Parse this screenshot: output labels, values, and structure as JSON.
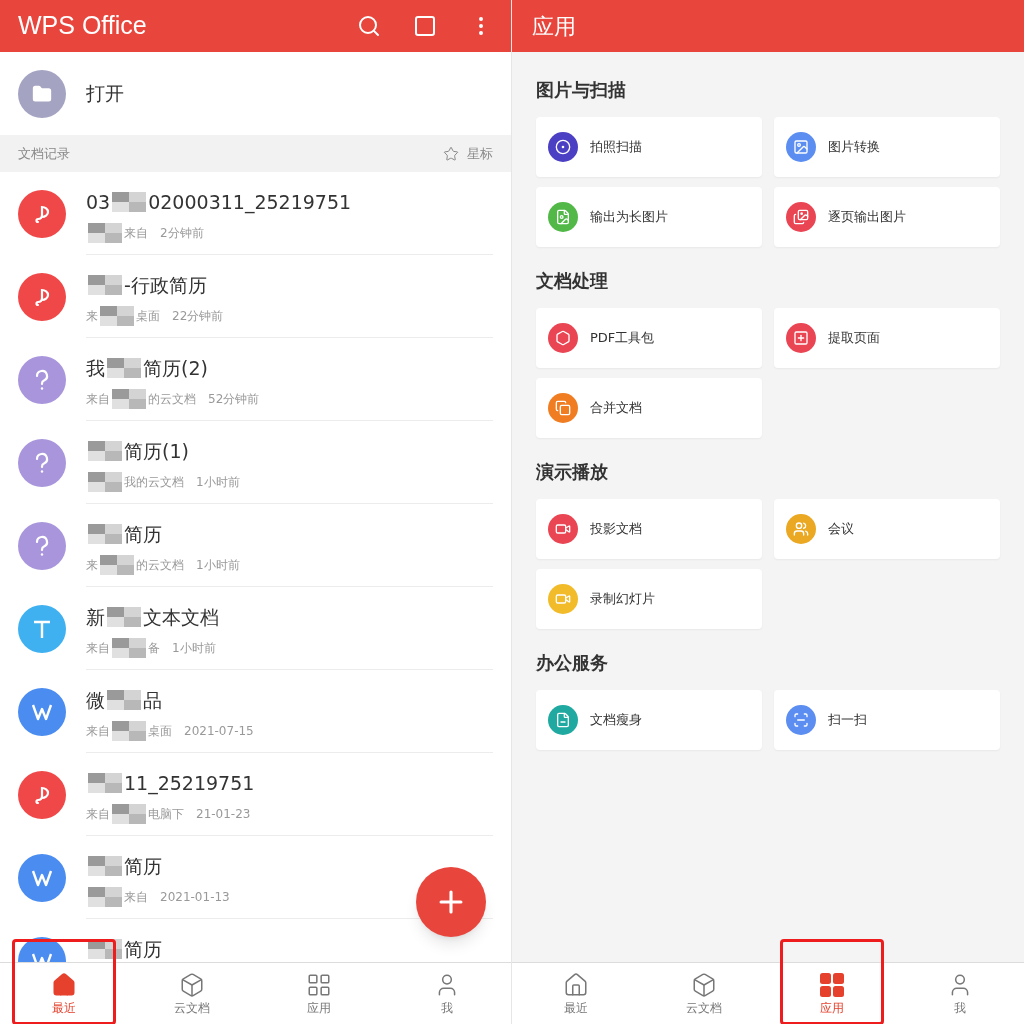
{
  "left": {
    "title": "WPS Office",
    "open_label": "打开",
    "section_label": "文档记录",
    "star_label": "星标",
    "files": [
      {
        "kind": "pdf",
        "name": [
          "03",
          "02000311_25219751"
        ],
        "source": [
          "来自"
        ],
        "time": "2分钟前"
      },
      {
        "kind": "pdf",
        "name": [
          "-行政简历"
        ],
        "source": [
          "来",
          "桌面"
        ],
        "time": "22分钟前"
      },
      {
        "kind": "unknown",
        "name": [
          "我",
          "简历(2)"
        ],
        "source": [
          "来自",
          "的云文档"
        ],
        "time": "52分钟前"
      },
      {
        "kind": "unknown",
        "name": [
          "简历(1)"
        ],
        "source": [
          "我的云文档"
        ],
        "time": "1小时前"
      },
      {
        "kind": "unknown",
        "name": [
          "简历"
        ],
        "source": [
          "来",
          "的云文档"
        ],
        "time": "1小时前"
      },
      {
        "kind": "text",
        "name": [
          "新",
          "文本文档"
        ],
        "source": [
          "来自",
          "备"
        ],
        "time": "1小时前"
      },
      {
        "kind": "writer",
        "name": [
          "微",
          "品"
        ],
        "source": [
          "来自",
          "桌面"
        ],
        "time": "2021-07-15"
      },
      {
        "kind": "pdf",
        "name": [
          "11_25219751"
        ],
        "source": [
          "来自",
          "电脑下"
        ],
        "time": "21-01-23"
      },
      {
        "kind": "writer",
        "name": [
          "简历"
        ],
        "source": [
          "来自"
        ],
        "time": "2021-01-13"
      },
      {
        "kind": "writer",
        "name": [
          "简历"
        ]
      }
    ],
    "nav": [
      {
        "label": "最近",
        "selected": true,
        "highlighted": true
      },
      {
        "label": "云文档",
        "selected": false,
        "highlighted": false
      },
      {
        "label": "应用",
        "selected": false,
        "highlighted": false
      },
      {
        "label": "我",
        "selected": false,
        "highlighted": false
      }
    ]
  },
  "right": {
    "title": "应用",
    "sections": [
      {
        "title": "图片与扫描",
        "tools": [
          {
            "label": "拍照扫描",
            "color": "#4b3fc4"
          },
          {
            "label": "图片转换",
            "color": "#5b8ef0"
          },
          {
            "label": "输出为长图片",
            "color": "#52b948"
          },
          {
            "label": "逐页输出图片",
            "color": "#ea4553"
          }
        ]
      },
      {
        "title": "文档处理",
        "tools": [
          {
            "label": "PDF工具包",
            "color": "#ea4553"
          },
          {
            "label": "提取页面",
            "color": "#ea4553"
          },
          {
            "label": "合并文档",
            "color": "#f07d22"
          }
        ]
      },
      {
        "title": "演示播放",
        "tools": [
          {
            "label": "投影文档",
            "color": "#ea4553"
          },
          {
            "label": "会议",
            "color": "#eba823"
          },
          {
            "label": "录制幻灯片",
            "color": "#f1bb2a"
          }
        ]
      },
      {
        "title": "办公服务",
        "tools": [
          {
            "label": "文档瘦身",
            "color": "#1fa9a0"
          },
          {
            "label": "扫一扫",
            "color": "#5b8ef0"
          }
        ]
      }
    ],
    "nav": [
      {
        "label": "最近",
        "selected": false,
        "highlighted": false
      },
      {
        "label": "云文档",
        "selected": false,
        "highlighted": false
      },
      {
        "label": "应用",
        "selected": true,
        "highlighted": true
      },
      {
        "label": "我",
        "selected": false,
        "highlighted": false
      }
    ]
  }
}
